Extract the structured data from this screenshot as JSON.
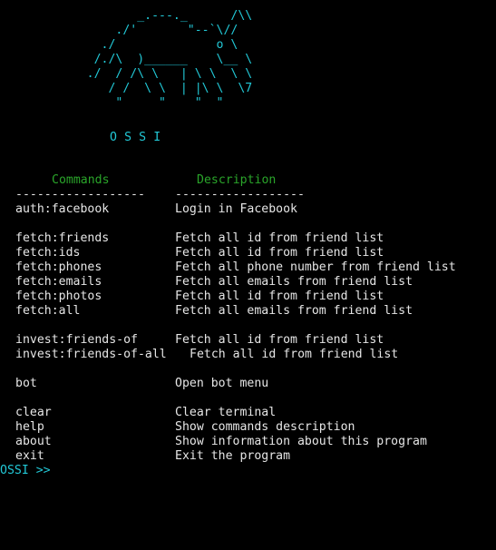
{
  "terminal": {
    "ascii_logo": "             _.---._      /\\\\\n          ./'       \"--`\\//\n        ./              o \\\n       /./\\  )______    \\__ \\\n      ./  / /\\ \\   | \\ \\  \\ \\\n         / /  \\ \\  | |\\ \\  \\7\n          \"     \"    \"  \"",
    "app_title": "O S S I",
    "headers": {
      "commands": "Commands",
      "description": "Description"
    },
    "separator_left": "------------------",
    "separator_right": "------------------",
    "commands": [
      {
        "cmd": "auth:facebook",
        "desc": "Login in Facebook"
      },
      {
        "cmd": "",
        "desc": ""
      },
      {
        "cmd": "fetch:friends",
        "desc": "Fetch all id from friend list"
      },
      {
        "cmd": "fetch:ids",
        "desc": "Fetch all id from friend list"
      },
      {
        "cmd": "fetch:phones",
        "desc": "Fetch all phone number from friend list"
      },
      {
        "cmd": "fetch:emails",
        "desc": "Fetch all emails from friend list"
      },
      {
        "cmd": "fetch:photos",
        "desc": "Fetch all id from friend list"
      },
      {
        "cmd": "fetch:all",
        "desc": "Fetch all emails from friend list"
      },
      {
        "cmd": "",
        "desc": ""
      },
      {
        "cmd": "invest:friends-of",
        "desc": "Fetch all id from friend list"
      },
      {
        "cmd": "invest:friends-of-all",
        "desc": "Fetch all id from friend list"
      },
      {
        "cmd": "",
        "desc": ""
      },
      {
        "cmd": "bot",
        "desc": "Open bot menu"
      },
      {
        "cmd": "",
        "desc": ""
      },
      {
        "cmd": "clear",
        "desc": "Clear terminal"
      },
      {
        "cmd": "help",
        "desc": "Show commands description"
      },
      {
        "cmd": "about",
        "desc": "Show information about this program"
      },
      {
        "cmd": "exit",
        "desc": "Exit the program"
      }
    ],
    "prompt": "OSSI >>",
    "colors": {
      "background": "#000000",
      "accent_cyan": "#22c8d6",
      "header_green": "#2aa52a",
      "text": "#e6e6e6"
    }
  }
}
